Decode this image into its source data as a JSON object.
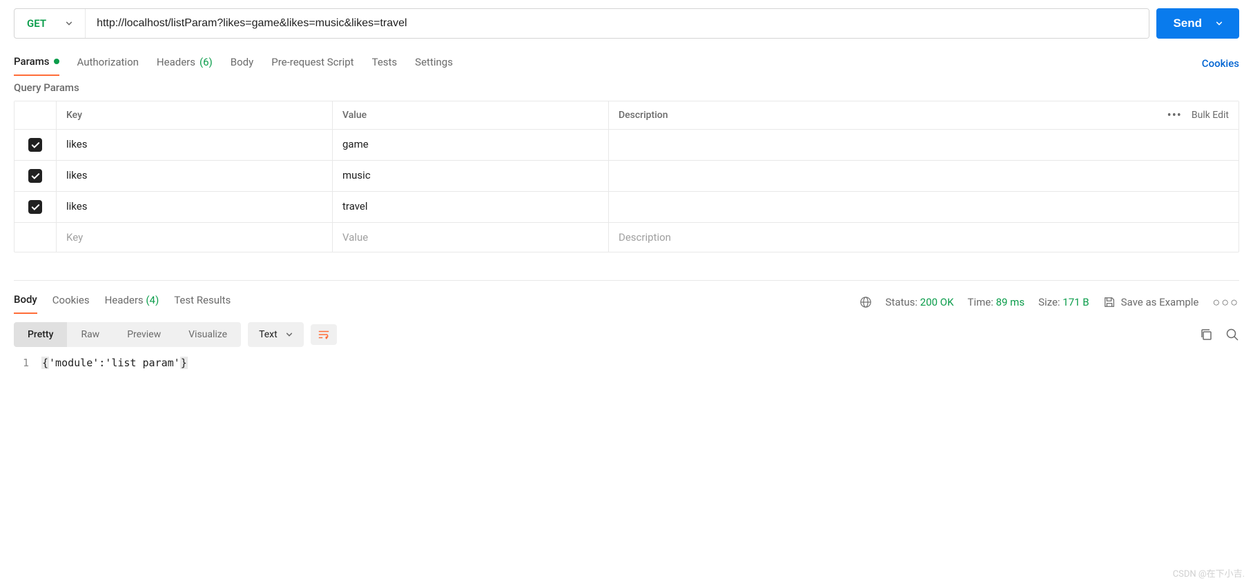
{
  "request": {
    "method": "GET",
    "url": "http://localhost/listParam?likes=game&likes=music&likes=travel",
    "send_label": "Send"
  },
  "tabs": {
    "params": "Params",
    "authorization": "Authorization",
    "headers": "Headers",
    "headers_count": "(6)",
    "body": "Body",
    "pre_request": "Pre-request Script",
    "tests": "Tests",
    "settings": "Settings",
    "cookies_link": "Cookies"
  },
  "query_params": {
    "title": "Query Params",
    "headers": {
      "key": "Key",
      "value": "Value",
      "description": "Description",
      "bulk_edit": "Bulk Edit"
    },
    "rows": [
      {
        "key": "likes",
        "value": "game",
        "description": ""
      },
      {
        "key": "likes",
        "value": "music",
        "description": ""
      },
      {
        "key": "likes",
        "value": "travel",
        "description": ""
      }
    ],
    "placeholder": {
      "key": "Key",
      "value": "Value",
      "description": "Description"
    }
  },
  "response": {
    "tabs": {
      "body": "Body",
      "cookies": "Cookies",
      "headers": "Headers",
      "headers_count": "(4)",
      "test_results": "Test Results"
    },
    "status_label": "Status:",
    "status_value": "200 OK",
    "time_label": "Time:",
    "time_value": "89 ms",
    "size_label": "Size:",
    "size_value": "171 B",
    "save_example": "Save as Example",
    "view_tabs": {
      "pretty": "Pretty",
      "raw": "Raw",
      "preview": "Preview",
      "visualize": "Visualize"
    },
    "format": "Text",
    "body_line_num": "1",
    "body_text": "'module':'list param'"
  },
  "watermark": "CSDN @在下小吉."
}
